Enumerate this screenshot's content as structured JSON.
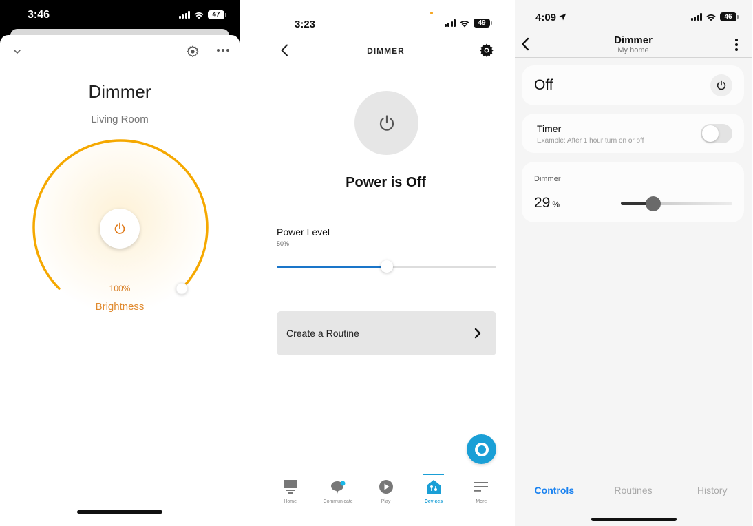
{
  "panels": {
    "smartlife": {
      "status": {
        "time": "3:46",
        "battery": "47"
      },
      "header": {
        "collapse_icon": "chevron-down-icon",
        "settings_icon": "gear-icon",
        "more_icon": "more-horizontal-icon"
      },
      "device_name": "Dimmer",
      "room": "Living Room",
      "brightness": {
        "value_percent": 100,
        "value_label": "100%",
        "label": "Brightness"
      },
      "colors": {
        "accent": "#f5a800",
        "text_accent": "#e08a2e"
      }
    },
    "alexa": {
      "status": {
        "time": "3:23",
        "battery": "49"
      },
      "header": {
        "title": "DIMMER"
      },
      "power_state": "Power is Off",
      "power_level": {
        "label": "Power Level",
        "value_label": "50%",
        "value_percent": 50
      },
      "routine_button": "Create a Routine",
      "tabs": [
        {
          "label": "Home",
          "icon": "home-icon",
          "active": false
        },
        {
          "label": "Communicate",
          "icon": "chat-bubble-icon",
          "active": false
        },
        {
          "label": "Play",
          "icon": "play-icon",
          "active": false
        },
        {
          "label": "Devices",
          "icon": "devices-house-icon",
          "active": true
        },
        {
          "label": "More",
          "icon": "menu-icon",
          "active": false
        }
      ],
      "colors": {
        "accent": "#1a9fd6",
        "slider": "#1a75c9"
      }
    },
    "smartthings": {
      "status": {
        "time": "4:09",
        "battery": "46"
      },
      "header": {
        "title": "Dimmer",
        "subtitle": "My home"
      },
      "power": {
        "state": "Off"
      },
      "timer": {
        "label": "Timer",
        "description": "Example: After 1 hour turn on or off",
        "enabled": false
      },
      "dimmer": {
        "label": "Dimmer",
        "value": "29",
        "unit": "%",
        "value_percent": 29
      },
      "tabs": [
        {
          "label": "Controls",
          "active": true
        },
        {
          "label": "Routines",
          "active": false
        },
        {
          "label": "History",
          "active": false
        }
      ],
      "colors": {
        "accent": "#1a82f0"
      }
    }
  }
}
